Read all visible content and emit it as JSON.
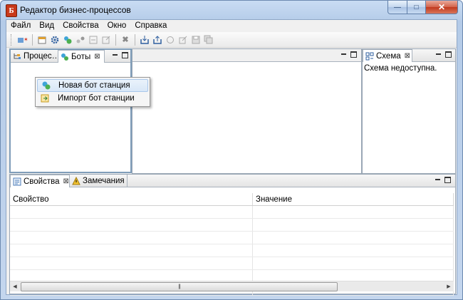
{
  "window": {
    "title": "Редактор бизнес-процессов",
    "app_icon_glyph": "Б",
    "controls": {
      "minimize": "—",
      "maximize": "□",
      "close": "✕"
    }
  },
  "menu": [
    "Файл",
    "Вид",
    "Свойства",
    "Окно",
    "Справка"
  ],
  "toolbar_icons": [
    "new-bot-station-icon",
    "new-process-icon",
    "settings-gear-icon",
    "bots-icon",
    "link-icon",
    "import-icon",
    "export-icon",
    "delete-icon",
    "deploy-icon",
    "upload-icon",
    "refresh-icon",
    "publish-icon",
    "save-icon",
    "save-all-icon"
  ],
  "left_panel": {
    "tabs": [
      {
        "label": "Процес…"
      },
      {
        "label": "Боты",
        "active": true
      }
    ]
  },
  "context_menu": {
    "items": [
      {
        "label": "Новая бот станция",
        "highlighted": true
      },
      {
        "label": "Импорт бот станции"
      }
    ]
  },
  "scheme_panel": {
    "tab_label": "Схема",
    "message": "Схема недоступна."
  },
  "bottom_panel": {
    "tabs": [
      {
        "label": "Свойства",
        "active": true
      },
      {
        "label": "Замечания"
      }
    ],
    "columns": [
      "Свойство",
      "Значение"
    ]
  },
  "scrollbar": {
    "thumb_grip": "|||"
  },
  "colors": {
    "titlebar": "#b9d1ea",
    "close_button": "#c8391a",
    "highlight": "#d8e7f7"
  }
}
